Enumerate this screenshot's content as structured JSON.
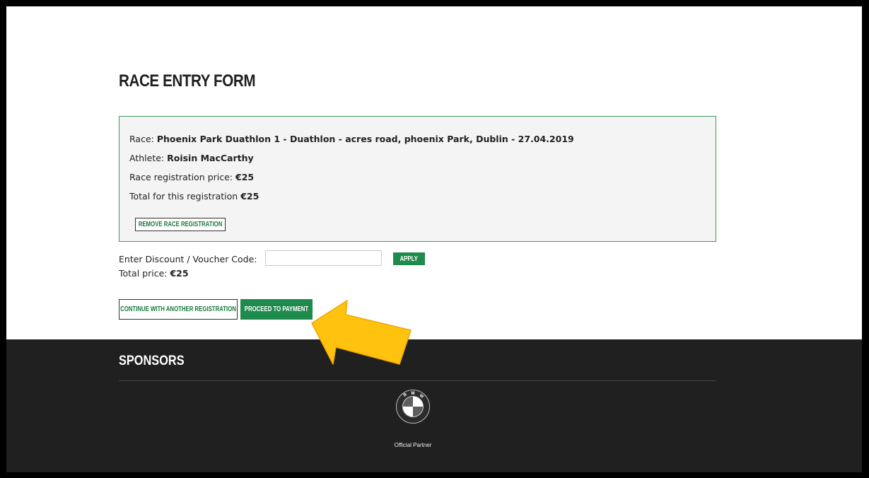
{
  "page": {
    "title": "RACE ENTRY FORM"
  },
  "summary": {
    "race_label": "Race:",
    "race_value": "Phoenix Park Duathlon 1 - Duathlon - acres road, phoenix Park, Dublin - 27.04.2019",
    "athlete_label": "Athlete:",
    "athlete_value": "Roisin MacCarthy",
    "price_label": "Race registration price:",
    "price_value": "€25",
    "total_label": "Total for this registration",
    "total_value": "€25",
    "remove_button": "REMOVE RACE REGISTRATION"
  },
  "voucher": {
    "label": "Enter Discount / Voucher Code:",
    "value": "",
    "apply_button": "APPLY"
  },
  "total": {
    "label": "Total price:",
    "value": "€25"
  },
  "actions": {
    "continue_button": "CONTINUE WITH ANOTHER REGISTRATION",
    "proceed_button": "PROCEED TO PAYMENT"
  },
  "footer": {
    "sponsors_title": "SPONSORS",
    "partner_logo_text": "BMW",
    "partner_caption": "Official Partner"
  },
  "colors": {
    "accent_green": "#1e8a4c",
    "footer_bg": "#202020",
    "annotation_arrow": "#ffc20e"
  },
  "icons": {
    "annotation": "arrow-pointer-icon",
    "sponsor": "bmw-logo-icon"
  }
}
